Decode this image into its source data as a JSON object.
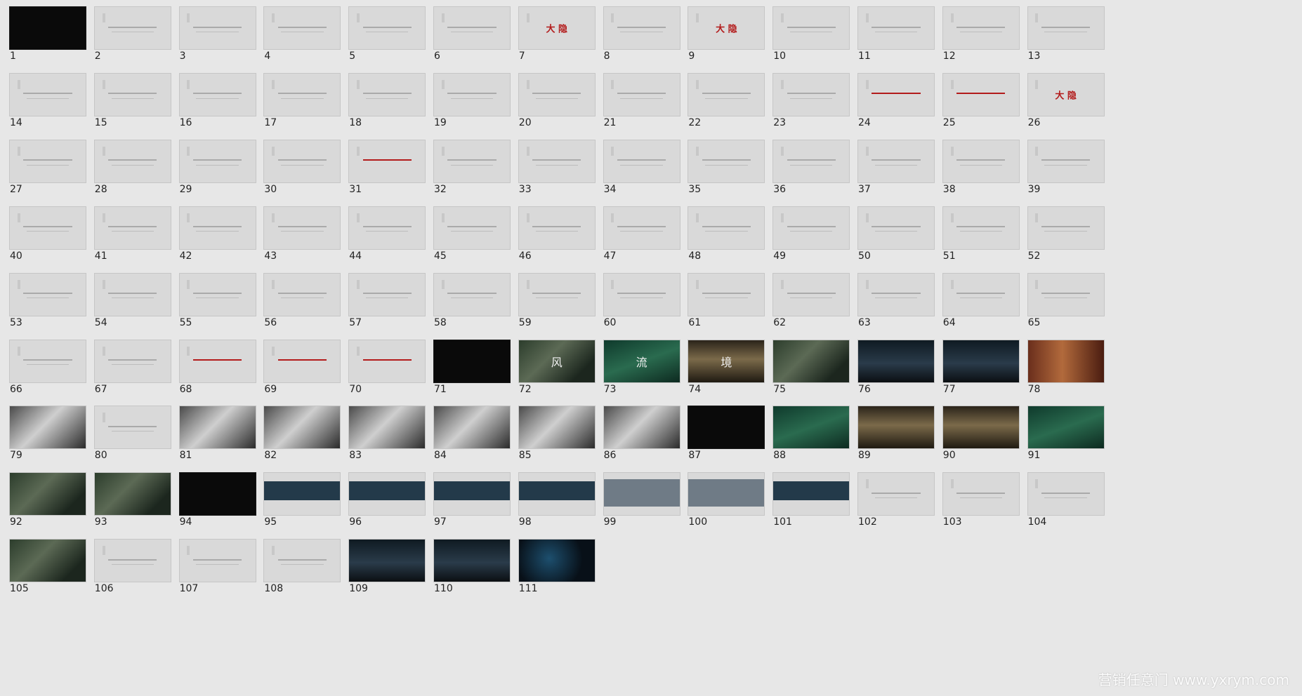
{
  "slides": [
    {
      "n": "1",
      "style": "dark"
    },
    {
      "n": "2",
      "style": "text"
    },
    {
      "n": "3",
      "style": "text"
    },
    {
      "n": "4",
      "style": "text"
    },
    {
      "n": "5",
      "style": "text"
    },
    {
      "n": "6",
      "style": "text"
    },
    {
      "n": "7",
      "style": "red",
      "mark": "大 隐"
    },
    {
      "n": "8",
      "style": "text"
    },
    {
      "n": "9",
      "style": "red",
      "mark": "大 隐"
    },
    {
      "n": "10",
      "style": "text"
    },
    {
      "n": "11",
      "style": "text"
    },
    {
      "n": "12",
      "style": "text"
    },
    {
      "n": "13",
      "style": "text"
    },
    {
      "n": "14",
      "style": "text"
    },
    {
      "n": "15",
      "style": "text"
    },
    {
      "n": "16",
      "style": "text"
    },
    {
      "n": "17",
      "style": "text"
    },
    {
      "n": "18",
      "style": "text"
    },
    {
      "n": "19",
      "style": "text"
    },
    {
      "n": "20",
      "style": "text"
    },
    {
      "n": "21",
      "style": "text"
    },
    {
      "n": "22",
      "style": "text"
    },
    {
      "n": "23",
      "style": "text"
    },
    {
      "n": "24",
      "style": "red",
      "mark": ""
    },
    {
      "n": "25",
      "style": "red",
      "mark": ""
    },
    {
      "n": "26",
      "style": "red",
      "mark": "大 隐"
    },
    {
      "n": "27",
      "style": "text"
    },
    {
      "n": "28",
      "style": "text"
    },
    {
      "n": "29",
      "style": "text"
    },
    {
      "n": "30",
      "style": "text"
    },
    {
      "n": "31",
      "style": "red",
      "mark": ""
    },
    {
      "n": "32",
      "style": "text"
    },
    {
      "n": "33",
      "style": "text"
    },
    {
      "n": "34",
      "style": "text"
    },
    {
      "n": "35",
      "style": "text"
    },
    {
      "n": "36",
      "style": "text"
    },
    {
      "n": "37",
      "style": "text"
    },
    {
      "n": "38",
      "style": "text"
    },
    {
      "n": "39",
      "style": "text"
    },
    {
      "n": "40",
      "style": "text"
    },
    {
      "n": "41",
      "style": "text"
    },
    {
      "n": "42",
      "style": "text"
    },
    {
      "n": "43",
      "style": "text"
    },
    {
      "n": "44",
      "style": "text"
    },
    {
      "n": "45",
      "style": "text"
    },
    {
      "n": "46",
      "style": "text"
    },
    {
      "n": "47",
      "style": "text"
    },
    {
      "n": "48",
      "style": "text"
    },
    {
      "n": "49",
      "style": "text"
    },
    {
      "n": "50",
      "style": "text"
    },
    {
      "n": "51",
      "style": "text"
    },
    {
      "n": "52",
      "style": "text"
    },
    {
      "n": "53",
      "style": "text"
    },
    {
      "n": "54",
      "style": "text"
    },
    {
      "n": "55",
      "style": "text"
    },
    {
      "n": "56",
      "style": "text"
    },
    {
      "n": "57",
      "style": "text"
    },
    {
      "n": "58",
      "style": "text"
    },
    {
      "n": "59",
      "style": "text"
    },
    {
      "n": "60",
      "style": "text"
    },
    {
      "n": "61",
      "style": "text"
    },
    {
      "n": "62",
      "style": "text"
    },
    {
      "n": "63",
      "style": "text"
    },
    {
      "n": "64",
      "style": "text"
    },
    {
      "n": "65",
      "style": "text"
    },
    {
      "n": "66",
      "style": "text"
    },
    {
      "n": "67",
      "style": "text"
    },
    {
      "n": "68",
      "style": "red",
      "mark": ""
    },
    {
      "n": "69",
      "style": "red",
      "mark": ""
    },
    {
      "n": "70",
      "style": "red",
      "mark": ""
    },
    {
      "n": "71",
      "style": "dark"
    },
    {
      "n": "72",
      "style": "photo",
      "mark": "风"
    },
    {
      "n": "73",
      "style": "green",
      "mark": "流"
    },
    {
      "n": "74",
      "style": "gold",
      "mark": "境"
    },
    {
      "n": "75",
      "style": "photo"
    },
    {
      "n": "76",
      "style": "photo2"
    },
    {
      "n": "77",
      "style": "photo2"
    },
    {
      "n": "78",
      "style": "wood"
    },
    {
      "n": "79",
      "style": "bw"
    },
    {
      "n": "80",
      "style": "text"
    },
    {
      "n": "81",
      "style": "bw"
    },
    {
      "n": "82",
      "style": "bw"
    },
    {
      "n": "83",
      "style": "bw"
    },
    {
      "n": "84",
      "style": "bw"
    },
    {
      "n": "85",
      "style": "bw"
    },
    {
      "n": "86",
      "style": "bw"
    },
    {
      "n": "87",
      "style": "dark"
    },
    {
      "n": "88",
      "style": "green"
    },
    {
      "n": "89",
      "style": "gold"
    },
    {
      "n": "90",
      "style": "gold"
    },
    {
      "n": "91",
      "style": "green"
    },
    {
      "n": "92",
      "style": "photo"
    },
    {
      "n": "93",
      "style": "photo"
    },
    {
      "n": "94",
      "style": "dark"
    },
    {
      "n": "95",
      "style": "bill"
    },
    {
      "n": "96",
      "style": "bill"
    },
    {
      "n": "97",
      "style": "bill"
    },
    {
      "n": "98",
      "style": "bill"
    },
    {
      "n": "99",
      "style": "mock"
    },
    {
      "n": "100",
      "style": "mock"
    },
    {
      "n": "101",
      "style": "bill"
    },
    {
      "n": "102",
      "style": "text"
    },
    {
      "n": "103",
      "style": "text"
    },
    {
      "n": "104",
      "style": "text"
    },
    {
      "n": "105",
      "style": "photo"
    },
    {
      "n": "106",
      "style": "text"
    },
    {
      "n": "107",
      "style": "text"
    },
    {
      "n": "108",
      "style": "text"
    },
    {
      "n": "109",
      "style": "photo2"
    },
    {
      "n": "110",
      "style": "photo2"
    },
    {
      "n": "111",
      "style": "night"
    }
  ],
  "watermark": "营销任意门 www.yxrym.com"
}
